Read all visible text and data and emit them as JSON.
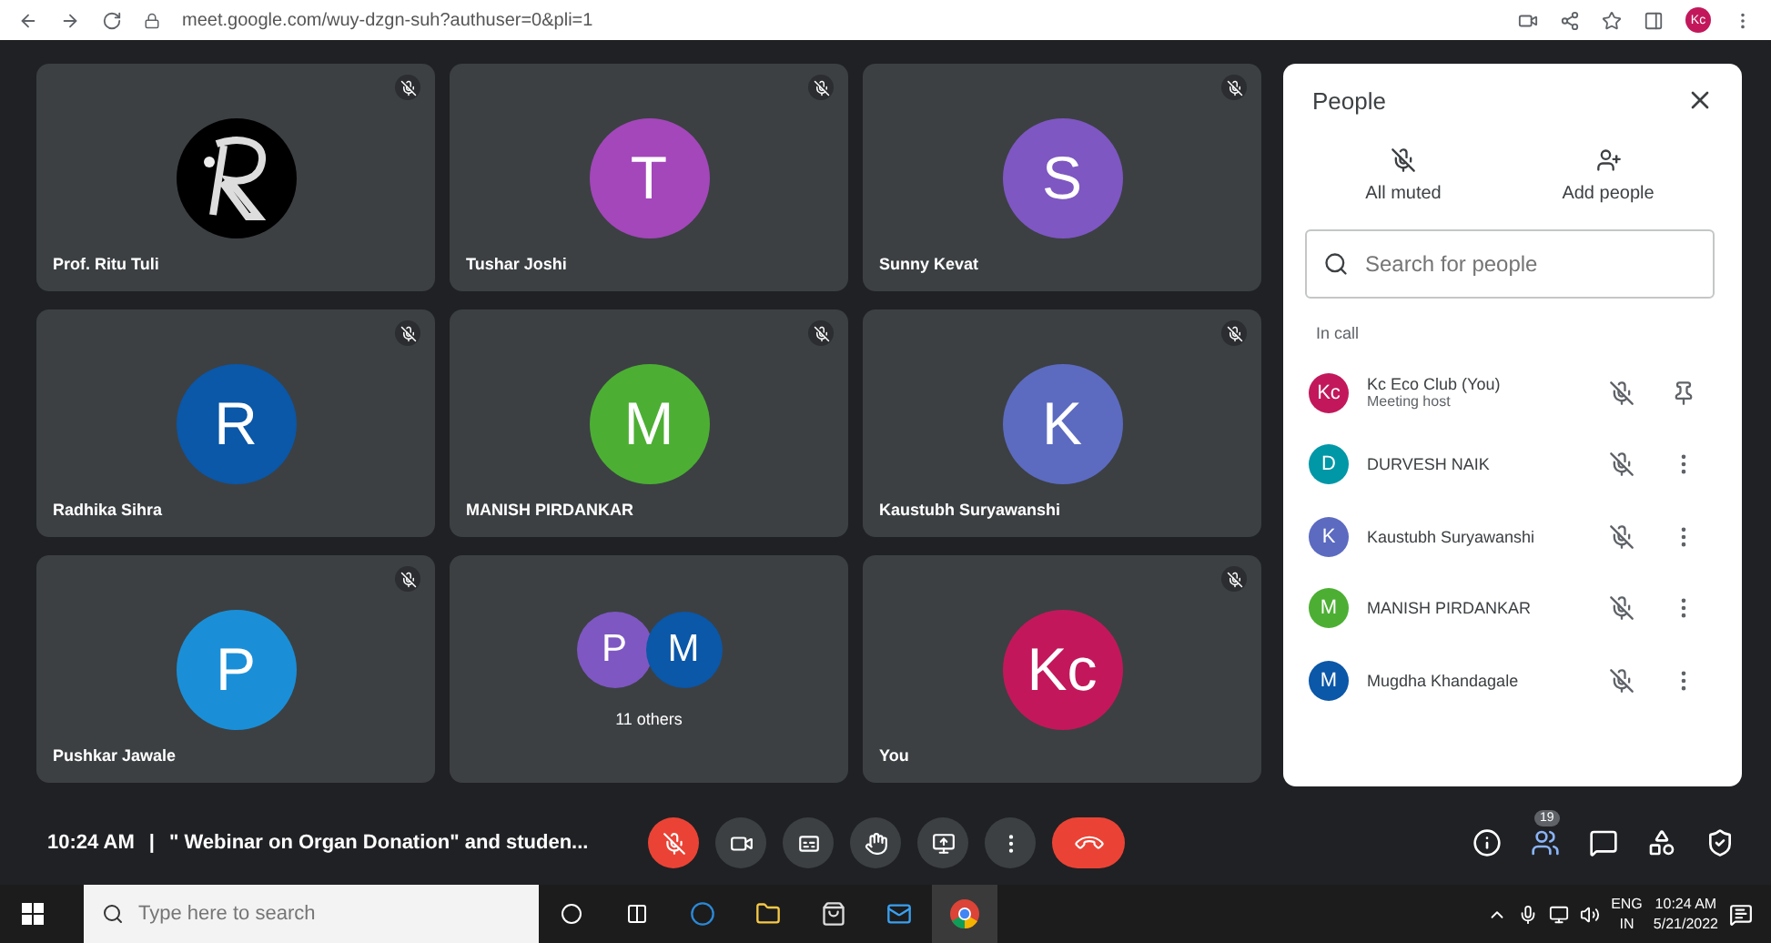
{
  "browser": {
    "url": "meet.google.com/wuy-dzgn-suh?authuser=0&pli=1",
    "profile": "Kc"
  },
  "tiles": [
    {
      "kind": "picture",
      "name": "Prof. Ritu Tuli",
      "muted": true
    },
    {
      "kind": "avatar",
      "name": "Tushar Joshi",
      "initials": "T",
      "color": "#a347ba",
      "muted": true
    },
    {
      "kind": "avatar",
      "name": "Sunny Kevat",
      "initials": "S",
      "color": "#7e57c2",
      "muted": true
    },
    {
      "kind": "avatar",
      "name": "Radhika Sihra",
      "initials": "R",
      "color": "#0b57a8",
      "muted": true
    },
    {
      "kind": "avatar",
      "name": "MANISH PIRDANKAR",
      "initials": "M",
      "color": "#4caf33",
      "muted": true
    },
    {
      "kind": "avatar",
      "name": "Kaustubh Suryawanshi",
      "initials": "K",
      "color": "#5c6bc0",
      "muted": true
    },
    {
      "kind": "avatar",
      "name": "Pushkar Jawale",
      "initials": "P",
      "color": "#1a8fd8",
      "muted": true
    },
    {
      "kind": "group",
      "label": "11 others",
      "avatars": [
        {
          "initials": "P",
          "color": "#7e57c2"
        },
        {
          "initials": "M",
          "color": "#0b57a8"
        }
      ],
      "muted": false
    },
    {
      "kind": "avatar",
      "name": "You",
      "initials": "Kc",
      "color": "#c2185b",
      "muted": true
    }
  ],
  "people_panel": {
    "title": "People",
    "actions": [
      {
        "kind": "mute",
        "label": "All muted"
      },
      {
        "kind": "add",
        "label": "Add people"
      }
    ],
    "search": {
      "placeholder": "Search for people"
    },
    "section": "In call",
    "people": [
      {
        "name": "Kc Eco Club (You)",
        "role": "Meeting host",
        "initials": "Kc",
        "color": "#c2185b",
        "kind": "pin"
      },
      {
        "name": "DURVESH NAIK",
        "initials": "D",
        "color": "#0097a7",
        "kind": "more"
      },
      {
        "name": "Kaustubh Suryawanshi",
        "initials": "K",
        "color": "#5c6bc0",
        "kind": "more"
      },
      {
        "name": "MANISH PIRDANKAR",
        "initials": "M",
        "color": "#4caf33",
        "kind": "more"
      },
      {
        "name": "Mugdha Khandagale",
        "initials": "M",
        "color": "#0b57a8",
        "kind": "more"
      }
    ]
  },
  "meeting_bar": {
    "time": "10:24 AM",
    "separator": "|",
    "title": "\" Webinar on Organ Donation\" and studen...",
    "people_count": "19"
  },
  "taskbar": {
    "search_placeholder": "Type here to search",
    "language": "ENG",
    "region": "IN",
    "time": "10:24 AM",
    "date": "5/21/2022"
  }
}
